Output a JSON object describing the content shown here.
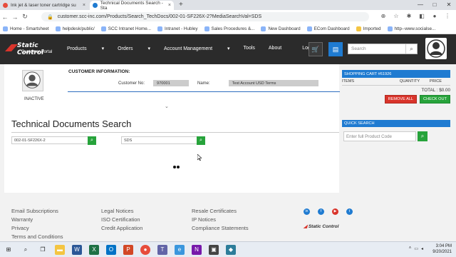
{
  "browser": {
    "tabs": [
      {
        "title": "Ink jet & laser toner cartridge su",
        "active": false
      },
      {
        "title": "Technical Documents Search - Sta",
        "active": true
      }
    ],
    "url": "customer.scc-inc.com/Products/Search_TechDocs/002-01-SF226X-2?MediaSearchVal=SDS",
    "bookmarks": [
      "Home - Smartsheet",
      "helpdesk/public/",
      "SCC Intranet Home...",
      "Intranet - Hubley",
      "Sales Procedures &...",
      "New Dashboard",
      "ECom Dashboard",
      "Imported",
      "http--www.socialse..."
    ]
  },
  "header": {
    "logo_line1": "Static Control",
    "logo_line2": "Customer Portal",
    "menu": [
      {
        "label": "Products",
        "dropdown": true
      },
      {
        "label": "Orders",
        "dropdown": true
      },
      {
        "label": "Account Management",
        "dropdown": true
      },
      {
        "label": "Tools",
        "dropdown": false
      },
      {
        "label": "About",
        "dropdown": false
      },
      {
        "label": "Logout",
        "dropdown": false
      }
    ],
    "search_placeholder": "Search"
  },
  "customer": {
    "section_title": "CUSTOMER INFORMATION:",
    "status": "INACTIVE",
    "customer_no_label": "Customer No:",
    "customer_no": "970001",
    "name_label": "Name:",
    "name": "Test Account USD Terms"
  },
  "tech_search": {
    "title": "Technical Documents Search",
    "part_value": "002-01-SF226X-2",
    "media_value": "SDS"
  },
  "cart": {
    "title": "SHOPPING CART #61926",
    "col_items": "ITEMS",
    "col_qty": "QUANTITY",
    "col_price": "PRICE",
    "total": "TOTAL : $0.00",
    "remove_label": "REMOVE ALL",
    "checkout_label": "CHECK OUT"
  },
  "quick_search": {
    "title": "QUICK SEARCH",
    "placeholder": "Enter full Product Code"
  },
  "footer": {
    "col1": [
      "Email Subscriptions",
      "Warranty",
      "Privacy",
      "Terms and Conditions"
    ],
    "col2": [
      "Legal Notices",
      "ISO Certification",
      "Credit Application"
    ],
    "col3": [
      "Resale Certificates",
      "IP Notices",
      "Compliance Statements"
    ],
    "logo": "Static Control"
  },
  "taskbar": {
    "time": "3:04 PM",
    "date": "9/20/2021"
  },
  "colors": {
    "accent_blue": "#1f7bd1",
    "green": "#27a33b",
    "red": "#d9342b",
    "header_dark": "#2b2b2b"
  }
}
